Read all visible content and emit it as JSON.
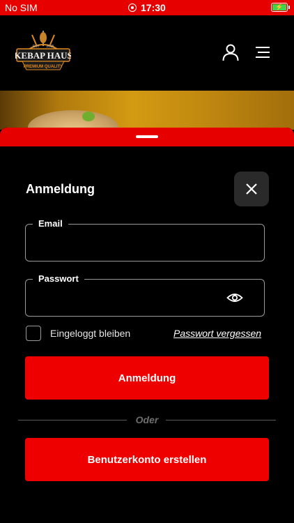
{
  "status_bar": {
    "carrier": "No SIM",
    "time": "17:30",
    "battery_icon": "battery-charging-icon"
  },
  "header": {
    "logo": {
      "text": "KEBAP HAUS",
      "sub_text": "PREMIUM QUALITY",
      "est": "EST",
      "year": "2015"
    },
    "user_icon": "user-icon",
    "menu_icon": "hamburger-menu-icon"
  },
  "login_sheet": {
    "title": "Anmeldung",
    "close_icon": "close-icon",
    "email_label": "Email",
    "email_value": "",
    "password_label": "Passwort",
    "password_value": "",
    "password_toggle_icon": "eye-icon",
    "remember_label": "Eingeloggt bleiben",
    "remember_checked": false,
    "forgot_link": "Passwort vergessen",
    "login_button": "Anmeldung",
    "divider_text": "Oder",
    "register_button": "Benutzerkonto erstellen"
  },
  "colors": {
    "accent": "#ee0000",
    "background": "#000000",
    "status_bar": "#e60000"
  }
}
